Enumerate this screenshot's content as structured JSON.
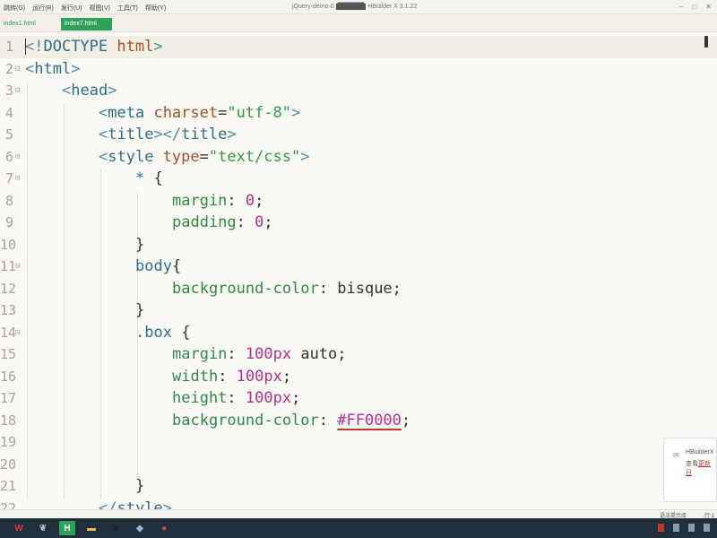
{
  "menubar": {
    "items": [
      "跳转(G)",
      "运行(R)",
      "发行(U)",
      "视图(V)",
      "工具(T)",
      "帮助(Y)"
    ],
    "window_title": "jQuery-demo-0",
    "app_name": "HBuilder X 3.1.22"
  },
  "tabs": [
    {
      "label": "index1.html",
      "active": false
    },
    {
      "label": "index7.html",
      "active": true
    }
  ],
  "editor": {
    "lines": [
      {
        "n": "1",
        "fold": "",
        "indent": 0,
        "tokens": [
          [
            "punc",
            "<!"
          ],
          [
            "tag",
            "DOCTYPE"
          ],
          [
            "plain",
            " "
          ],
          [
            "kw",
            "html"
          ],
          [
            "punc",
            ">"
          ]
        ]
      },
      {
        "n": "2",
        "fold": "⊟",
        "indent": 0,
        "tokens": [
          [
            "punc",
            "<"
          ],
          [
            "tag",
            "html"
          ],
          [
            "punc",
            ">"
          ]
        ]
      },
      {
        "n": "3",
        "fold": "⊟",
        "indent": 1,
        "tokens": [
          [
            "punc",
            "<"
          ],
          [
            "tag",
            "head"
          ],
          [
            "punc",
            ">"
          ]
        ]
      },
      {
        "n": "4",
        "fold": "",
        "indent": 2,
        "tokens": [
          [
            "punc",
            "<"
          ],
          [
            "tag",
            "meta"
          ],
          [
            "plain",
            " "
          ],
          [
            "attr",
            "charset"
          ],
          [
            "plain",
            "="
          ],
          [
            "str",
            "\"utf-8\""
          ],
          [
            "punc",
            ">"
          ]
        ]
      },
      {
        "n": "5",
        "fold": "",
        "indent": 2,
        "tokens": [
          [
            "punc",
            "<"
          ],
          [
            "tag",
            "title"
          ],
          [
            "punc",
            "></"
          ],
          [
            "tag",
            "title"
          ],
          [
            "punc",
            ">"
          ]
        ]
      },
      {
        "n": "6",
        "fold": "⊟",
        "indent": 2,
        "tokens": [
          [
            "punc",
            "<"
          ],
          [
            "tag",
            "style"
          ],
          [
            "plain",
            " "
          ],
          [
            "attr",
            "type"
          ],
          [
            "plain",
            "="
          ],
          [
            "str",
            "\"text/css\""
          ],
          [
            "punc",
            ">"
          ]
        ]
      },
      {
        "n": "7",
        "fold": "⊟",
        "indent": 3,
        "tokens": [
          [
            "sel",
            "*"
          ],
          [
            "plain",
            " {"
          ]
        ]
      },
      {
        "n": "8",
        "fold": "",
        "indent": 4,
        "tokens": [
          [
            "prop",
            "margin"
          ],
          [
            "plain",
            ": "
          ],
          [
            "num",
            "0"
          ],
          [
            "plain",
            ";"
          ]
        ]
      },
      {
        "n": "9",
        "fold": "",
        "indent": 4,
        "tokens": [
          [
            "prop",
            "padding"
          ],
          [
            "plain",
            ": "
          ],
          [
            "num",
            "0"
          ],
          [
            "plain",
            ";"
          ]
        ]
      },
      {
        "n": "10",
        "fold": "",
        "indent": 3,
        "tokens": [
          [
            "plain",
            "}"
          ]
        ]
      },
      {
        "n": "11",
        "fold": "⊟",
        "indent": 3,
        "tokens": [
          [
            "sel",
            "body"
          ],
          [
            "plain",
            "{"
          ]
        ]
      },
      {
        "n": "12",
        "fold": "",
        "indent": 4,
        "tokens": [
          [
            "prop",
            "background-color"
          ],
          [
            "plain",
            ": "
          ],
          [
            "val",
            "bisque"
          ],
          [
            "plain",
            ";"
          ]
        ]
      },
      {
        "n": "13",
        "fold": "",
        "indent": 3,
        "tokens": [
          [
            "plain",
            "}"
          ]
        ]
      },
      {
        "n": "14",
        "fold": "⊟",
        "indent": 3,
        "tokens": [
          [
            "sel",
            ".box"
          ],
          [
            "plain",
            " {"
          ]
        ]
      },
      {
        "n": "15",
        "fold": "",
        "indent": 4,
        "tokens": [
          [
            "prop",
            "margin"
          ],
          [
            "plain",
            ": "
          ],
          [
            "num",
            "100px"
          ],
          [
            "plain",
            " "
          ],
          [
            "val",
            "auto"
          ],
          [
            "plain",
            ";"
          ]
        ]
      },
      {
        "n": "16",
        "fold": "",
        "indent": 4,
        "tokens": [
          [
            "prop",
            "width"
          ],
          [
            "plain",
            ": "
          ],
          [
            "num",
            "100px"
          ],
          [
            "plain",
            ";"
          ]
        ]
      },
      {
        "n": "17",
        "fold": "",
        "indent": 4,
        "tokens": [
          [
            "prop",
            "height"
          ],
          [
            "plain",
            ": "
          ],
          [
            "num",
            "100px"
          ],
          [
            "plain",
            ";"
          ]
        ]
      },
      {
        "n": "18",
        "fold": "",
        "indent": 4,
        "tokens": [
          [
            "prop",
            "background-color"
          ],
          [
            "plain",
            ": "
          ],
          [
            "hex",
            "#FF0000"
          ],
          [
            "plain",
            ";"
          ]
        ]
      },
      {
        "n": "19",
        "fold": "",
        "indent": 4,
        "tokens": []
      },
      {
        "n": "20",
        "fold": "",
        "indent": 4,
        "tokens": []
      },
      {
        "n": "21",
        "fold": "",
        "indent": 3,
        "tokens": [
          [
            "plain",
            "}"
          ]
        ]
      },
      {
        "n": "22",
        "fold": "",
        "indent": 2,
        "tokens": [
          [
            "punc",
            "</"
          ],
          [
            "tag",
            "style"
          ],
          [
            "punc",
            ">"
          ]
        ]
      }
    ]
  },
  "notification": {
    "title": "HBuilderX",
    "body": "查看",
    "link": "更新日"
  },
  "statusbar": {
    "hint": "语法提示库",
    "position": "行:1"
  },
  "taskbar": {
    "apps": [
      {
        "icon": "wps-icon",
        "glyph": "W",
        "color": "#e53935"
      },
      {
        "icon": "bird-icon",
        "glyph": "❦",
        "color": "#bbbbbb"
      },
      {
        "icon": "hbuilder-icon",
        "glyph": "H",
        "color": "#ffffff"
      },
      {
        "icon": "folder-icon",
        "glyph": "▬",
        "color": "#e8b84a"
      },
      {
        "icon": "terminal-icon",
        "glyph": "■",
        "color": "#222222"
      },
      {
        "icon": "app-icon",
        "glyph": "◆",
        "color": "#9fb6d8"
      },
      {
        "icon": "chrome-icon",
        "glyph": "●",
        "color": "#db4437"
      }
    ]
  },
  "colors": {
    "editor_bg": "#fbf9f3",
    "current_line": "#f1eee4",
    "active_tab": "#2ea25a",
    "taskbar": "#1f2f3c"
  }
}
